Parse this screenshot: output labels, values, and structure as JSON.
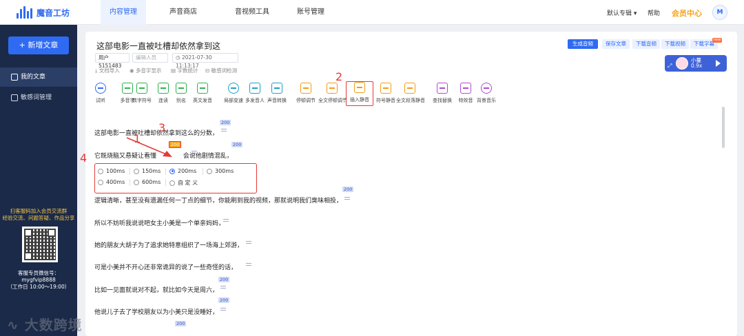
{
  "app": {
    "name": "魔音工坊"
  },
  "topnav": {
    "tabs": [
      "内容管理",
      "声音商店",
      "音视频工具",
      "账号管理"
    ],
    "right": [
      "默认专辑",
      "帮助",
      "会员中心"
    ],
    "avatar_text": "M"
  },
  "sidebar": {
    "new_button": "+ 新增文章",
    "items": [
      "我的文章",
      "敏感词管理"
    ],
    "promo": [
      "扫客服码加入会员交流群",
      "经验交流、问题答疑、作品分享"
    ],
    "service": [
      "客服专员微信号：",
      "mygfvip8888",
      "（工作日 10:00～19:00）"
    ]
  },
  "doc": {
    "title": "这部电影一直被吐槽却依然拿到这",
    "user_id": "用户5151483",
    "editor_placeholder": "编辑人员",
    "date": "2021-07-30 11:13:17",
    "subtools": [
      "文档导入",
      "多音字显示",
      "字数统计",
      "敏感词检测"
    ],
    "header_buttons": [
      "生成音频",
      "保存文章",
      "下载音频",
      "下载视频",
      "下载字幕"
    ],
    "new_tag": "new",
    "player": {
      "name": "小蔓",
      "speed": "0.9x"
    }
  },
  "toolbar": [
    {
      "label": "试听",
      "color": "#2f6bf2"
    },
    {
      "label": "多音字",
      "color": "#2bb24c"
    },
    {
      "label": "数字符号",
      "color": "#2bb24c"
    },
    {
      "label": "连读",
      "color": "#2bb24c"
    },
    {
      "label": "别名",
      "color": "#2bb24c"
    },
    {
      "label": "英文发音",
      "color": "#2bb24c"
    },
    {
      "label": "局部变速",
      "color": "#1aa0c8"
    },
    {
      "label": "多发音人",
      "color": "#1aa0c8"
    },
    {
      "label": "声音转换",
      "color": "#1aa0c8"
    },
    {
      "label": "停顿调节",
      "color": "#f39c12"
    },
    {
      "label": "全文停顿调节",
      "color": "#f39c12"
    },
    {
      "label": "插入静音",
      "color": "#f39c12"
    },
    {
      "label": "符号静音",
      "color": "#f39c12"
    },
    {
      "label": "全文段落静音",
      "color": "#f39c12"
    },
    {
      "label": "查找替换",
      "color": "#b04ad1"
    },
    {
      "label": "特效音",
      "color": "#b04ad1"
    },
    {
      "label": "背景音乐",
      "color": "#b04ad1"
    }
  ],
  "content": {
    "lines": [
      "这部电影一直被吐槽却依然拿到这么的分数，",
      "它既烧脑又悬疑让看懂的人说它剧情混乱，",
      "逻辑清晰，甚至没有遗漏任何一丁点的细节，你能刷到我的视频，那就说明我们臭味相投，",
      "所以不妨听我说说吧女主小美是一个单亲妈妈，",
      "她的朋友大胡子为了追求她特意组织了一场海上郊游，",
      "可是小美并不开心还非常诡异的说了一些奇怪的话，",
      "比如一见面就说对不起，就比如今天是周六，",
      "他说儿子去了学校朋友以为小美只是没睡好，"
    ],
    "pause_value": "200",
    "inserted_value": "200",
    "line2_right": "会说他剧情混乱，"
  },
  "silence_options": {
    "options": [
      "100ms",
      "150ms",
      "200ms",
      "300ms",
      "400ms",
      "600ms",
      "自 定 义"
    ],
    "selected": "200ms"
  },
  "annotations": [
    "1",
    "2",
    "3",
    "4"
  ],
  "watermark": "大数跨境"
}
